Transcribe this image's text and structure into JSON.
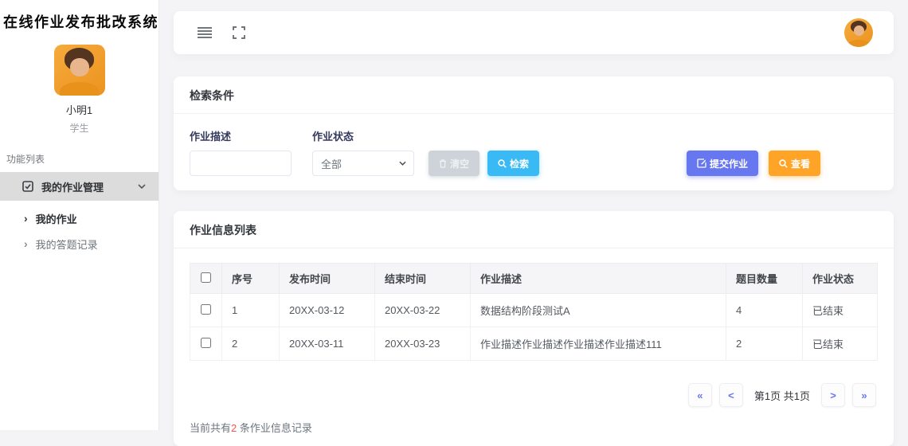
{
  "app_title": "在线作业发布批改系统",
  "sidebar": {
    "user": {
      "name": "小明1",
      "role": "学生"
    },
    "section_label": "功能列表",
    "menu": {
      "label": "我的作业管理"
    },
    "submenu": [
      {
        "label": "我的作业",
        "active": true
      },
      {
        "label": "我的答题记录",
        "active": false
      }
    ],
    "chevron_glyph": "›"
  },
  "search_panel": {
    "title": "检索条件",
    "desc_field": {
      "label": "作业描述",
      "value": ""
    },
    "status_field": {
      "label": "作业状态",
      "value": "全部"
    },
    "clear_button": "清空",
    "search_button": "检索",
    "submit_button": "提交作业",
    "view_button": "查看"
  },
  "table_panel": {
    "title": "作业信息列表",
    "columns": [
      "序号",
      "发布时间",
      "结束时间",
      "作业描述",
      "题目数量",
      "作业状态"
    ],
    "rows": [
      [
        "1",
        "20XX-03-12",
        "20XX-03-22",
        "数据结构阶段测试A",
        "4",
        "已结束"
      ],
      [
        "2",
        "20XX-03-11",
        "20XX-03-23",
        "作业描述作业描述作业描述作业描述111",
        "2",
        "已结束"
      ]
    ],
    "pagination": {
      "first": "«",
      "prev": "<",
      "info": "第1页 共1页",
      "next": ">",
      "last": "»"
    },
    "footer": {
      "prefix": "当前共有",
      "count": "2",
      "suffix": " 条作业信息记录"
    }
  },
  "colors": {
    "primary": "#6777ef",
    "info": "#3abaf4",
    "warning": "#ffa426",
    "danger": "#fc544b",
    "muted_button": "#cdd3d8"
  }
}
